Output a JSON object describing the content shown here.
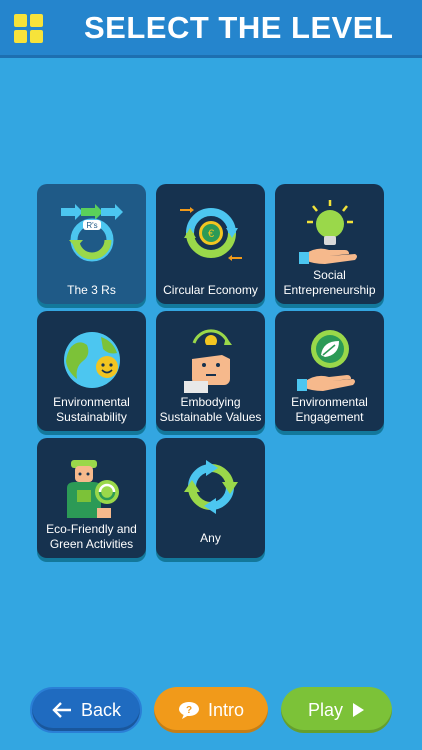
{
  "header": {
    "title": "SELECT THE LEVEL",
    "menu_icon": "grid-menu-icon"
  },
  "levels": [
    {
      "label": "The 3 Rs",
      "selected": true,
      "icon": "reduce-reuse-recycle-icon"
    },
    {
      "label": "Circular Economy",
      "selected": false,
      "icon": "circular-economy-icon"
    },
    {
      "label": "Social Entrepreneurship",
      "selected": false,
      "icon": "lightbulb-hand-icon"
    },
    {
      "label": "Environmental Sustainability",
      "selected": false,
      "icon": "smiling-earth-icon"
    },
    {
      "label": "Embodying Sustainable Values",
      "selected": false,
      "icon": "thinking-person-icon"
    },
    {
      "label": "Environmental Engagement",
      "selected": false,
      "icon": "leaf-hand-icon"
    },
    {
      "label": "Eco-Friendly and Green Activities",
      "selected": false,
      "icon": "gardener-icon"
    },
    {
      "label": "Any",
      "selected": false,
      "icon": "cycle-arrows-icon"
    }
  ],
  "footer": {
    "back_label": "Back",
    "intro_label": "Intro",
    "play_label": "Play"
  },
  "colors": {
    "background": "#33a6e1",
    "header": "#2585cd",
    "tile": "#16324f",
    "tile_selected": "#1f5a87",
    "back": "#1f6bc0",
    "intro": "#f19a1a",
    "play": "#7cc238",
    "menu_icon": "#f7e33a"
  }
}
